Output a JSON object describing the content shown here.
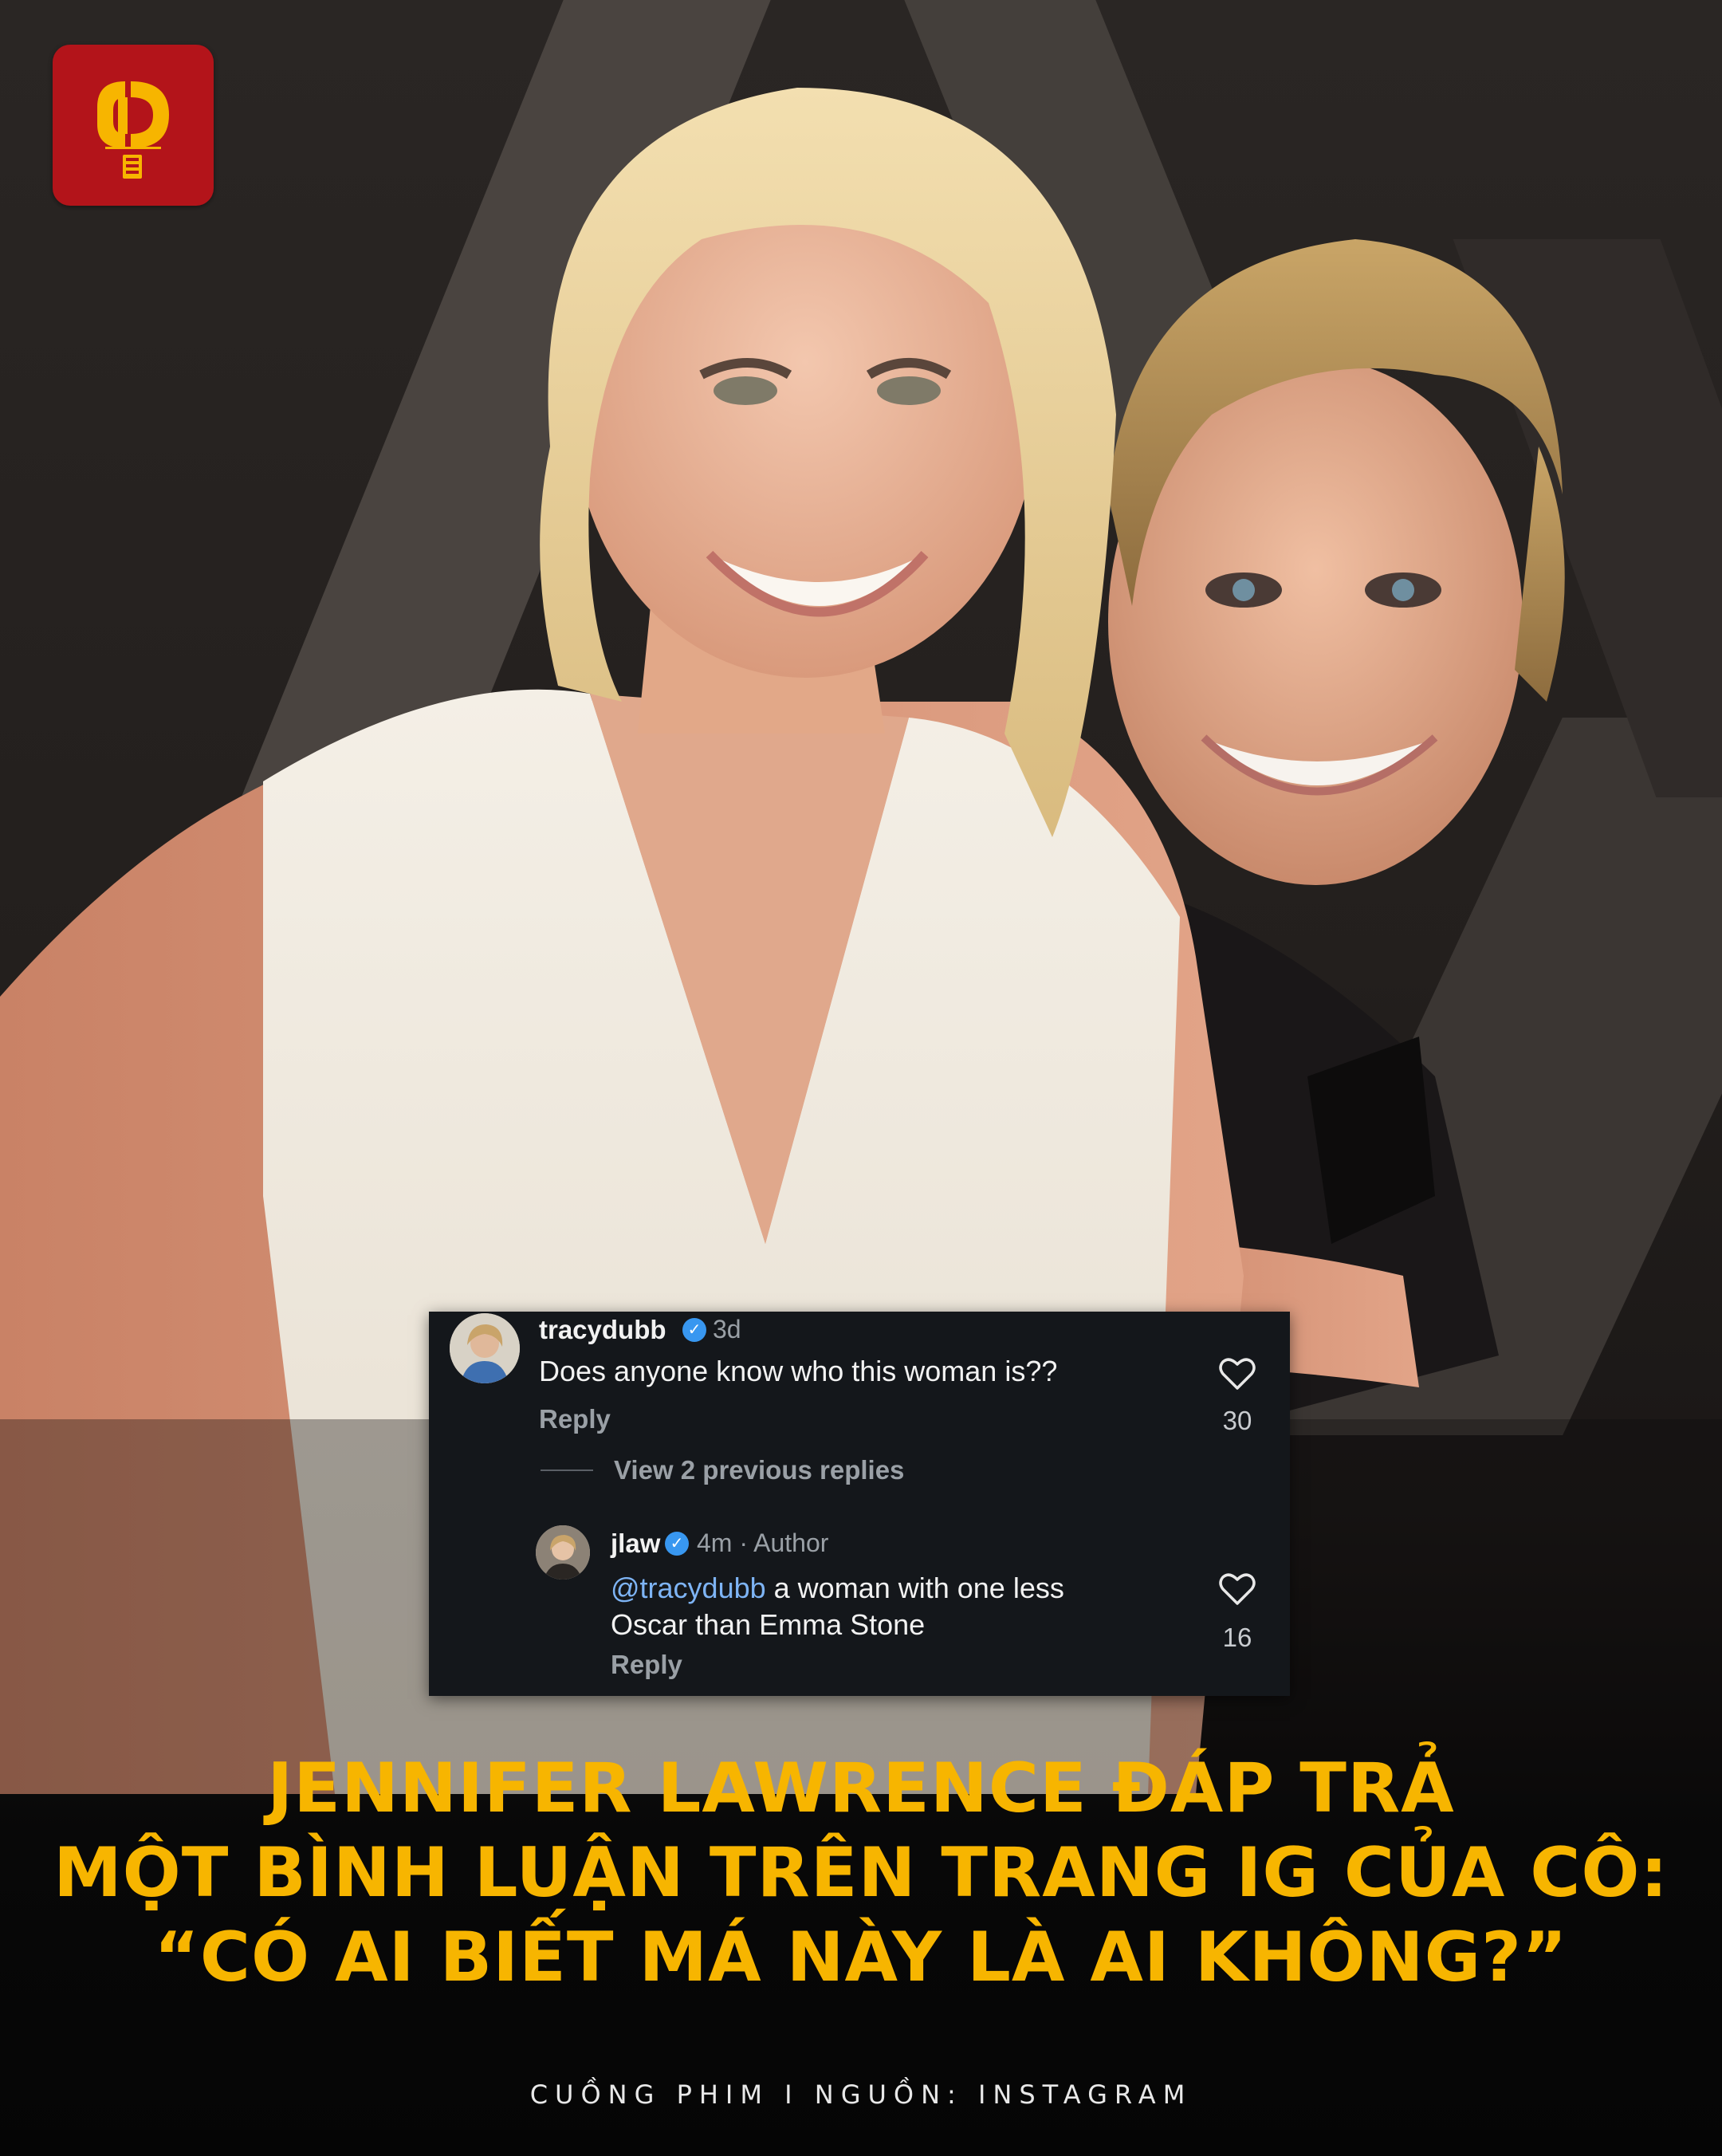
{
  "brand": {
    "logo_icon": "cuong-phim-logo-icon",
    "logo_color": "#b3141a",
    "logo_accent": "#f7b500"
  },
  "comment_card": {
    "comment": {
      "username": "tracydubb",
      "time": "3d",
      "text": "Does anyone know who this woman is??",
      "reply_label": "Reply",
      "likes": "30"
    },
    "view_previous": "View 2 previous replies",
    "reply": {
      "username": "jlaw",
      "time_author": "4m · Author",
      "mention": "@tracydubb",
      "text_line1": " a woman with one less",
      "text_line2": "Oscar than Emma Stone",
      "reply_label": "Reply",
      "likes": "16"
    }
  },
  "headline": {
    "line1": "JENNIFER LAWRENCE ĐÁP TRẢ",
    "line2": "MỘT BÌNH LUẬN TRÊN TRANG IG CỦA CÔ:",
    "line3": "“CÓ AI BIẾT MÁ NÀY LÀ AI KHÔNG?”",
    "color": "#f7b500"
  },
  "credit": "CUỒNG PHIM I NGUỒN: INSTAGRAM"
}
